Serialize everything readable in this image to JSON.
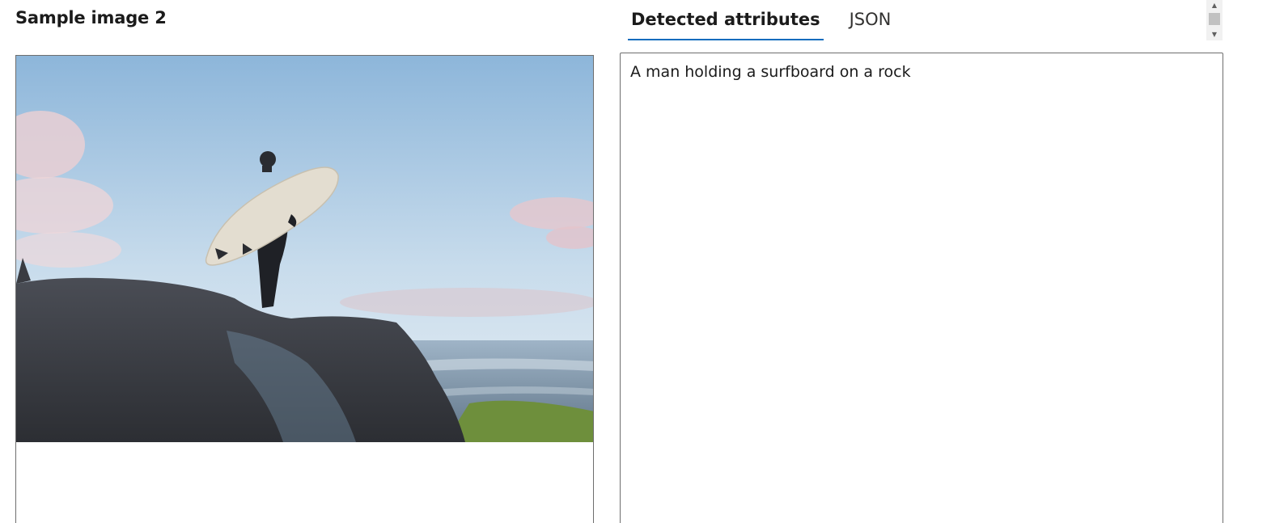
{
  "panel": {
    "title": "Sample image 2"
  },
  "image": {
    "subject": "Man in a wetsuit holding a surfboard, standing on a rock by the sea"
  },
  "tabs": [
    {
      "label": "Detected attributes",
      "selected": true
    },
    {
      "label": "JSON",
      "selected": false
    }
  ],
  "result": {
    "caption": "A man holding a surfboard on a rock"
  },
  "scrollbar": {
    "up_icon": "triangle-up",
    "down_icon": "triangle-down"
  },
  "colors": {
    "tab_underline": "#0f6cbd",
    "border": "#6e6e6e"
  }
}
